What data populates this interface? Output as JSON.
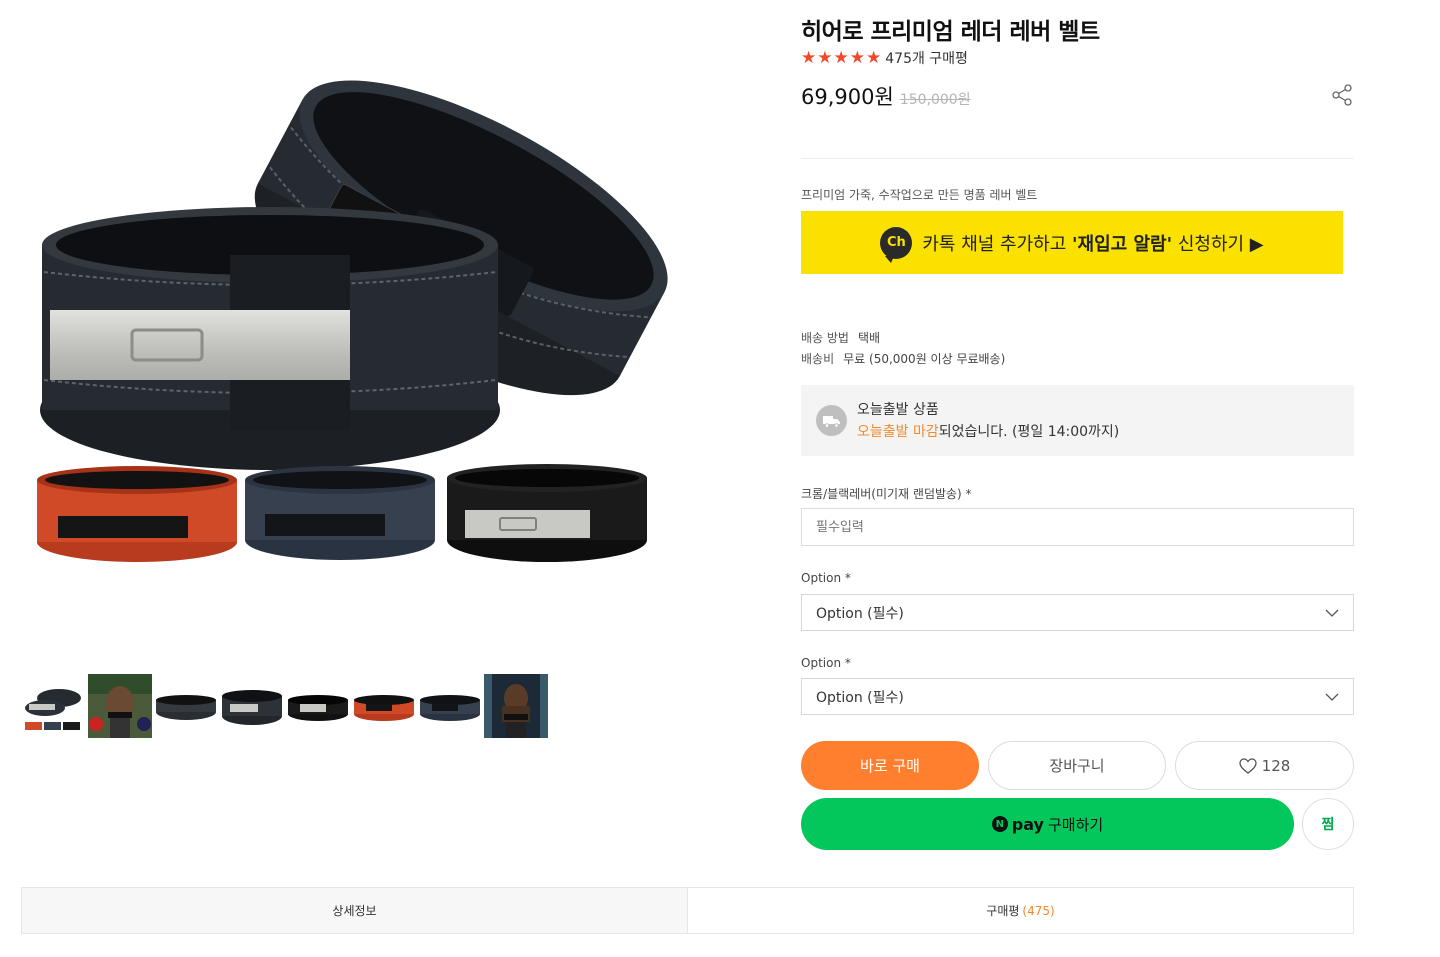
{
  "product": {
    "title": "히어로 프리미엄 레더 레버 벨트",
    "rating_count_text": "475개 구매평",
    "price": "69,900원",
    "original_price": "150,000원",
    "tagline": "프리미엄 가죽, 수작업으로 만든 명품 레버 벨트"
  },
  "kakao": {
    "badge": "Ch",
    "text_prefix": "카톡 채널 추가하고 ",
    "text_strong": "'재입고 알람'",
    "text_suffix": " 신청하기 ▶"
  },
  "shipping": {
    "method_label": "배송 방법",
    "method_value": "택배",
    "fee_label": "배송비",
    "fee_value": "무료 (50,000원 이상 무료배송)"
  },
  "today_shipping": {
    "title": "오늘출발 상품",
    "highlight": "오늘출발 마감",
    "rest": "되었습니다. (평일 14:00까지)"
  },
  "options": {
    "text_field_label": "크롬/블랙레버(미기재 랜덤발송) *",
    "text_field_placeholder": "필수입력",
    "select1_label": "Option *",
    "select1_value": "Option (필수)",
    "select2_label": "Option *",
    "select2_value": "Option (필수)"
  },
  "actions": {
    "buy": "바로 구매",
    "cart": "장바구니",
    "like_count": "128",
    "npay_word": "pay",
    "npay_text": "구매하기",
    "zzim": "찜"
  },
  "tabs": [
    {
      "label": "상세정보",
      "count": ""
    },
    {
      "label": "구매평",
      "count": "(475)"
    }
  ],
  "colors": {
    "accent_orange": "#ff7f2e",
    "kakao_yellow": "#fae100",
    "npay_green": "#03c75a",
    "star_red": "#f04a2a"
  },
  "icons": [
    "star-icon",
    "share-icon",
    "truck-icon",
    "chevron-down-icon",
    "heart-icon",
    "npay-logo-icon",
    "kakao-channel-icon"
  ]
}
